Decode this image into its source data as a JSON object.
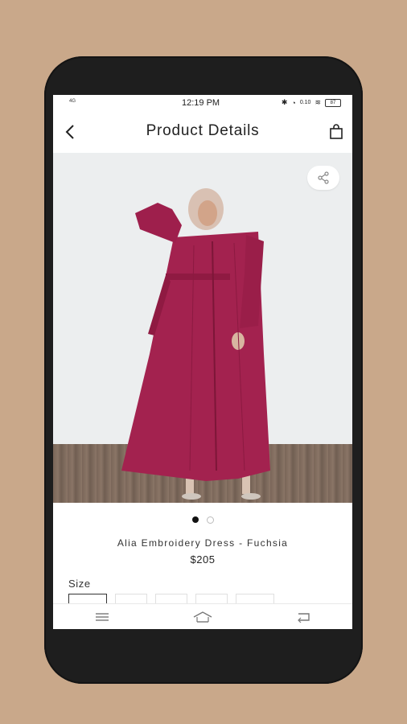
{
  "status_bar": {
    "network": "4G",
    "time": "12:19 PM",
    "speed": "0.10",
    "battery": "87"
  },
  "header": {
    "title": "Product Details"
  },
  "product": {
    "name": "Alia Embroidery Dress - Fuchsia",
    "price": "$205",
    "image_count": 2,
    "active_image_index": 0
  },
  "size": {
    "label": "Size",
    "option_count": 5
  },
  "icons": {
    "back": "chevron-left-icon",
    "bag": "shopping-bag-icon",
    "share": "share-icon",
    "menu": "menu-icon",
    "home": "home-icon",
    "recent": "back-nav-icon"
  },
  "colors": {
    "background": "#c9a88a",
    "phone": "#1e1e1e",
    "dress": "#a3224f"
  }
}
